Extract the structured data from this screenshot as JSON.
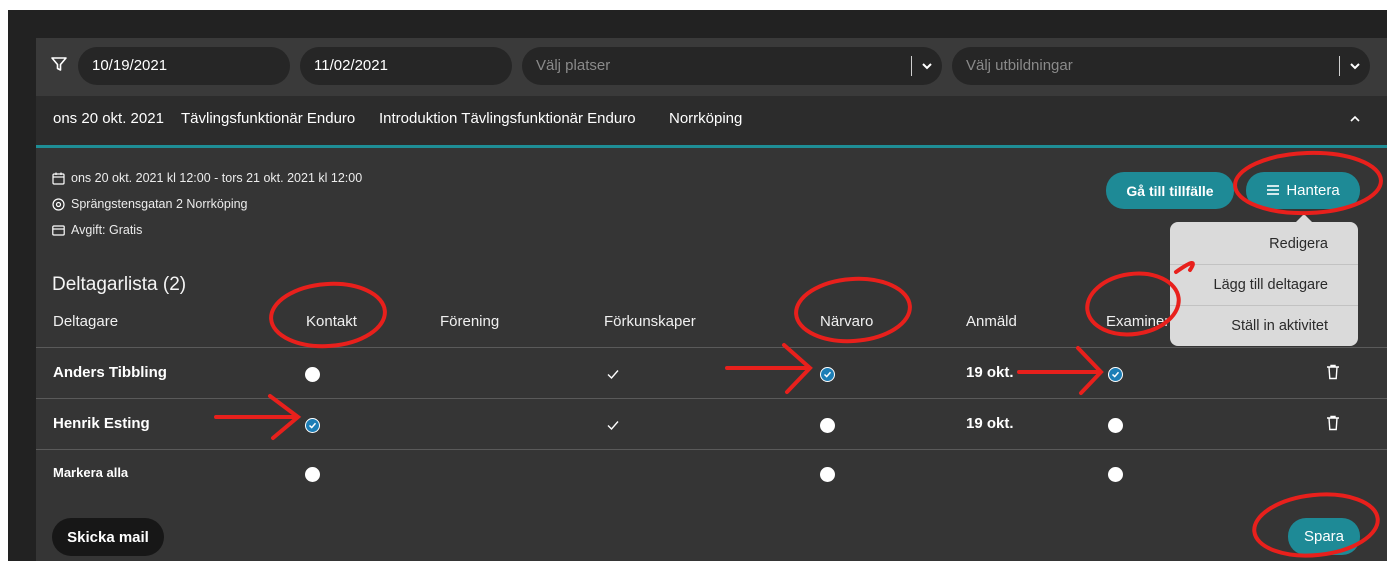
{
  "filters": {
    "date_from": "10/19/2021",
    "date_to": "11/02/2021",
    "locations_placeholder": "Välj platser",
    "educations_placeholder": "Välj utbildningar"
  },
  "event": {
    "date": "ons 20 okt. 2021",
    "type": "Tävlingsfunktionär Enduro",
    "course": "Introduktion Tävlingsfunktionär Enduro",
    "city": "Norrköping"
  },
  "details": {
    "time_range": "ons 20 okt. 2021 kl 12:00  -  tors 21 okt. 2021 kl 12:00",
    "address": "Sprängstensgatan 2 Norrköping",
    "fee": "Avgift: Gratis"
  },
  "actions": {
    "go_to_session": "Gå till tillfälle",
    "manage": "Hantera",
    "send_mail": "Skicka mail",
    "save": "Spara"
  },
  "manage_menu": {
    "items": [
      "Redigera",
      "Lägg till deltagare",
      "Ställ in aktivitet"
    ]
  },
  "participants": {
    "title": "Deltagarlista (2)",
    "columns": [
      "Deltagare",
      "Kontakt",
      "Förening",
      "Förkunskaper",
      "Närvaro",
      "Anmäld",
      "Examiner"
    ],
    "rows": [
      {
        "name": "Anders Tibbling",
        "contact": false,
        "prerequisites": true,
        "attendance": true,
        "registered": "19 okt.",
        "examined": true
      },
      {
        "name": "Henrik Esting",
        "contact": true,
        "prerequisites": true,
        "attendance": false,
        "registered": "19 okt.",
        "examined": false
      }
    ],
    "select_all": "Markera alla"
  },
  "colors": {
    "accent_teal": "#1e8a96",
    "checked_blue": "#1d7eb6",
    "annotation_red": "#e8201c"
  }
}
